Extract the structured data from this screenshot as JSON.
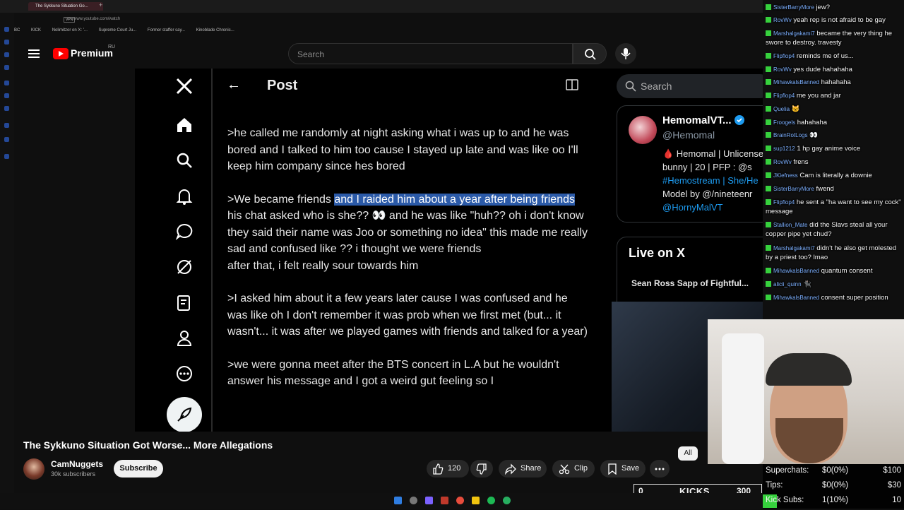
{
  "browser": {
    "tab_title": "The Sykkuno Situation Go...",
    "url": "www.youtube.com/watch",
    "vpn": "VPN",
    "bookmarks": [
      "BC",
      "KICK",
      "Nolimitzor on X: '...",
      "Supreme Court Ju...",
      "Former staffer say...",
      "Kinoblade Chronic..."
    ]
  },
  "youtube": {
    "logo_text": "Premium",
    "region": "RU",
    "search_placeholder": "Search",
    "video_title": "The Sykkuno Situation Got Worse... More Allegations",
    "channel": {
      "name": "CamNuggets",
      "subs": "30k subscribers",
      "subscribe_label": "Subscribe"
    },
    "actions": {
      "likes": "120",
      "share": "Share",
      "clip": "Clip",
      "save": "Save"
    },
    "chip_all": "All"
  },
  "x_post": {
    "header_title": "Post",
    "paragraphs": [
      {
        "text": ">he called me randomly at night asking what i was up to and he was bored and I talked to him too cause I stayed up late and was like oo I'll keep him company since hes bored"
      },
      {
        "pre": ">We became friends ",
        "highlight": "and I raided him about a year after being friends",
        "post": "his chat asked who is she?? 👀 and he was like \"huh?? oh i don't know they said their name was Joo or something no idea\" this made me really sad and confused like ?? i thought we were friends\nafter that, i felt really sour towards him"
      },
      {
        "text": ">I asked him about it a few years later cause I was confused and he was like oh I don't remember it was prob when we first met (but... it wasn't... it was after we played games with friends and talked for a year)"
      },
      {
        "text": ">we were gonna meet after the BTS concert in L.A but he wouldn't answer his message and I got a weird gut feeling so I"
      }
    ],
    "right_search": "Search",
    "profile": {
      "name": "HemomalVT...",
      "handle": "@Hemomal",
      "bio_1": "🩸 Hemomal | Unlicensed",
      "bio_2": "bunny | 20 | PFP : @s",
      "bio_3": "#Hemostream | She/He",
      "bio_4": "Model by @/nineteenr",
      "bio_5": "@HornyMalVT"
    },
    "live_title": "Live on X",
    "live_item": "Sean Ross Sapp of Fightful..."
  },
  "chat": [
    {
      "user": "SisterBarryMore",
      "text": "jew?"
    },
    {
      "user": "RovWv",
      "text": "yeah rep is not afraid to be gay"
    },
    {
      "user": "Marshalgakami7",
      "text": "became the very thing he swore to destroy. travesty"
    },
    {
      "user": "Flipflop4",
      "text": "reminds me of us..."
    },
    {
      "user": "RovWv",
      "text": "yes dude hahahaha"
    },
    {
      "user": "MihawkalsBanned",
      "text": "hahahaha"
    },
    {
      "user": "Flipflop4",
      "text": "me you and jar"
    },
    {
      "user": "Quelia",
      "text": "🐱"
    },
    {
      "user": "Froogels",
      "text": "hahahaha"
    },
    {
      "user": "BrainRotLogs",
      "text": "👀"
    },
    {
      "user": "sup1212",
      "text": "1 hp gay anime voice"
    },
    {
      "user": "RovWv",
      "text": "frens"
    },
    {
      "user": "JKiefness",
      "text": "Cam is literally a downie"
    },
    {
      "user": "SisterBarryMore",
      "text": "fwend"
    },
    {
      "user": "Flipflop4",
      "text": "he sent a \"ha want to see my cock\" message"
    },
    {
      "user": "Stallion_Mate",
      "text": "did the Slavs steal all your copper pipe yet chud?"
    },
    {
      "user": "Marshalgakami7",
      "text": "didn't he also get molested by a priest too? lmao"
    },
    {
      "user": "MihawkalsBanned",
      "text": "quantum consent"
    },
    {
      "user": "alicii_quinn",
      "text": "🐈‍⬛"
    },
    {
      "user": "MihawkalsBanned",
      "text": "consent super position"
    }
  ],
  "kicks_bar": {
    "left": "0",
    "label": "KICKS",
    "right": "300"
  },
  "stats": [
    {
      "label": "Superchats:",
      "value": "$0(0%)",
      "goal": "$100"
    },
    {
      "label": "Tips:",
      "value": "$0(0%)",
      "goal": "$30"
    },
    {
      "label": "Kick Subs:",
      "value": "1(10%)",
      "goal": "10"
    }
  ],
  "colors": {
    "yt_red": "#ff0000",
    "highlight": "#2b5aa8",
    "x_blue": "#1d9bf0",
    "chat_badge": "#36d13d"
  }
}
